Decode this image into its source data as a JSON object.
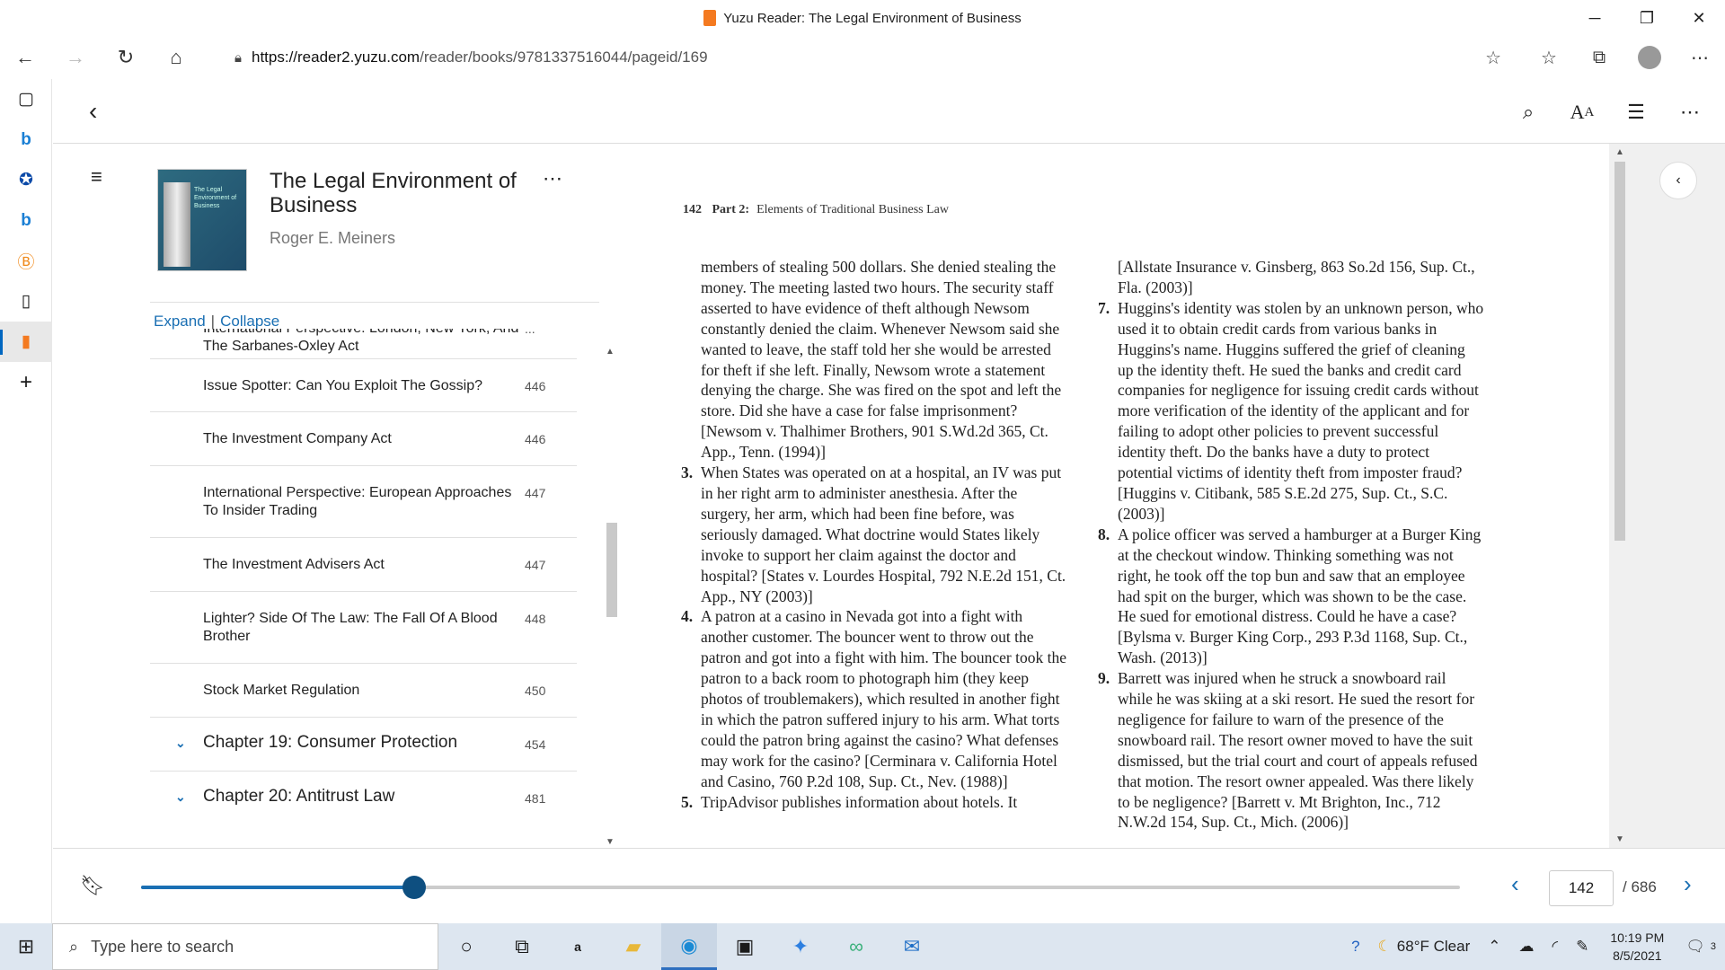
{
  "window": {
    "title": "Yuzu Reader: The Legal Environment of Business"
  },
  "browser": {
    "url_host": "https://reader2.yuzu.com",
    "url_path": "/reader/books/9781337516044/pageid/169"
  },
  "book": {
    "title": "The Legal Environment of Business",
    "author": "Roger E. Meiners",
    "cover_text": "The Legal Environment of Business"
  },
  "toc": {
    "expand_label": "Expand",
    "separator": "|",
    "collapse_label": "Collapse",
    "items": [
      {
        "label": "International Perspective: London, New York, And The Sarbanes-Oxley Act",
        "page": "..."
      },
      {
        "label": "Issue Spotter: Can You Exploit The Gossip?",
        "page": "446"
      },
      {
        "label": "The Investment Company Act",
        "page": "446"
      },
      {
        "label": "International Perspective: European Approaches To Insider Trading",
        "page": "447"
      },
      {
        "label": "The Investment Advisers Act",
        "page": "447"
      },
      {
        "label": "Lighter? Side Of The Law: The Fall Of A Blood Brother",
        "page": "448"
      },
      {
        "label": "Stock Market Regulation",
        "page": "450"
      },
      {
        "label": "Chapter 19: Consumer Protection",
        "page": "454"
      },
      {
        "label": "Chapter 20: Antitrust Law",
        "page": "481"
      }
    ]
  },
  "page": {
    "running_head_num": "142",
    "running_head_part": "Part 2:",
    "running_head_title": "Elements of Traditional Business Law",
    "left_col": [
      {
        "num": "",
        "text": "members of stealing 500 dollars. She denied stealing the money. The meeting lasted two hours. The security staff asserted to have evidence of theft although Newsom constantly denied the claim. Whenever Newsom said she wanted to leave, the staff told her she would be arrested for theft if she left. Finally, Newsom wrote a statement denying the charge. She was fired on the spot and left the store. Did she have a case for false imprisonment? [Newsom v. Thalhimer Brothers, 901 S.Wd.2d 365, Ct. App., Tenn. (1994)]"
      },
      {
        "num": "3.",
        "text": "When States was operated on at a hospital, an IV was put in her right arm to administer anesthesia. After the surgery, her arm, which had been fine before, was seriously damaged. What doctrine would States likely invoke to support her claim against the doctor and hospital? [States v. Lourdes Hospital, 792 N.E.2d 151, Ct. App., NY (2003)]"
      },
      {
        "num": "4.",
        "text": "A patron at a casino in Nevada got into a fight with another customer. The bouncer went to throw out the patron and got into a fight with him. The bouncer took the patron to a back room to photograph him (they keep photos of troublemakers), which resulted in another fight in which the patron suffered injury to his arm. What torts could the patron bring against the casino? What defenses may work for the casino? [Cerminara v. California Hotel and Casino, 760 P.2d 108, Sup. Ct., Nev. (1988)]"
      },
      {
        "num": "5.",
        "text": "TripAdvisor publishes information about hotels. It"
      }
    ],
    "right_col": [
      {
        "num": "",
        "text": "[Allstate Insurance v. Ginsberg, 863 So.2d 156, Sup. Ct., Fla. (2003)]"
      },
      {
        "num": "7.",
        "text": "Huggins's identity was stolen by an unknown person, who used it to obtain credit cards from various banks in Huggins's name. Huggins suffered the grief of cleaning up the identity theft. He sued the banks and credit card companies for negligence for issuing credit cards without more verification of the identity of the applicant and for failing to adopt other policies to prevent successful identity theft. Do the banks have a duty to protect potential victims of identity theft from imposter fraud? [Huggins v. Citibank, 585 S.E.2d 275, Sup. Ct., S.C. (2003)]"
      },
      {
        "num": "8.",
        "text": "A police officer was served a hamburger at a Burger King at the checkout window. Thinking something was not right, he took off the top bun and saw that an employee had spit on the burger, which was shown to be the case. He sued for emotional distress. Could he have a case? [Bylsma v. Burger King Corp., 293 P.3d 1168, Sup. Ct., Wash. (2013)]"
      },
      {
        "num": "9.",
        "text": "Barrett was injured when he struck a snowboard rail while he was skiing at a ski resort. He sued the resort for negligence for failure to warn of the presence of the snowboard rail. The resort owner moved to have the suit dismissed, but the trial court and court of appeals refused that motion. The resort owner appealed. Was there likely to be negligence? [Barrett v. Mt Brighton, Inc., 712 N.W.2d 154, Sup. Ct., Mich. (2006)]"
      }
    ]
  },
  "pager": {
    "current_page": "142",
    "total_pages": "/ 686",
    "progress_fraction": 0.207
  },
  "taskbar": {
    "search_placeholder": "Type here to search",
    "weather": "68°F  Clear",
    "time": "10:19 PM",
    "date": "8/5/2021",
    "notif_count": "3"
  },
  "icons": [
    "back-arrow-icon",
    "forward-arrow-icon",
    "refresh-icon",
    "home-icon",
    "lock-icon",
    "favorite-add-icon",
    "favorites-icon",
    "collections-icon",
    "profile-icon",
    "more-icon",
    "search-icon",
    "text-size-icon",
    "notes-icon",
    "hamburger-icon",
    "bookmark-icon",
    "windows-icon"
  ]
}
